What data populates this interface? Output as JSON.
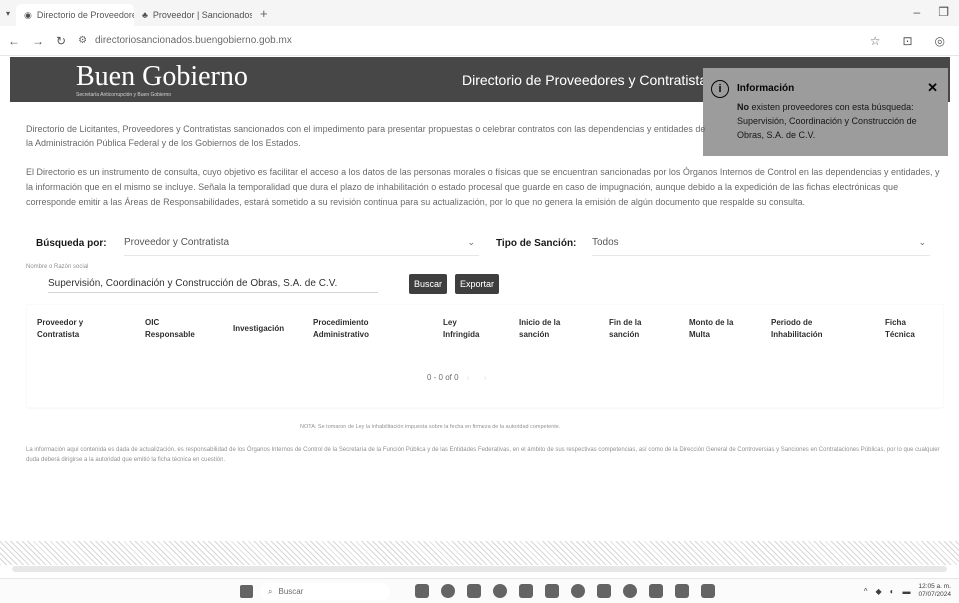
{
  "browser": {
    "tabs": [
      {
        "title": "Directorio de Proveedores y C",
        "active": true
      },
      {
        "title": "Proveedor | Sancionados",
        "active": false
      }
    ],
    "url": "directoriosancionados.buengobierno.gob.mx"
  },
  "header": {
    "brand": "Buen Gobierno",
    "brand_sub": "Secretaría Anticorrupción y Buen Gobierno",
    "title": "Directorio de Proveedores y Contratistas Sancionados"
  },
  "toast": {
    "title": "Información",
    "message_lead": "No",
    "message": "existen proveedores con esta búsqueda: Supervisión, Coordinación y Construcción de Obras, S.A. de C.V."
  },
  "intro": "Directorio de Licitantes, Proveedores y Contratistas sancionados con el impedimento para presentar propuestas o celebrar contratos con las dependencias y entidades de la Administración Pública Federal y de los Gobiernos de los Estados.",
  "paragraph": "El Directorio es un instrumento de consulta, cuyo objetivo es facilitar el acceso a los datos de las personas morales o físicas que se encuentran sancionadas por los Órganos Internos de Control en las dependencias y entidades, y la información que en el mismo se incluye. Señala la temporalidad que dura el plazo de inhabilitación o estado procesal que guarde en caso de impugnación, aunque debido a la expedición de las fichas electrónicas que corresponde emitir a las Áreas de Responsabilidades, estará sometido a su revisión continua para su actualización, por lo que no genera la emisión de algún documento que respalde su consulta.",
  "search": {
    "by_label": "Búsqueda por:",
    "by_value": "Proveedor y Contratista",
    "type_label": "Tipo de Sanción:",
    "type_value": "Todos",
    "hint": "Nombre o Razón social",
    "input_value": "Supervisión, Coordinación y Construcción de Obras, S.A. de C.V.",
    "search_button": "Buscar",
    "export_button": "Exportar"
  },
  "table": {
    "headers": [
      "Proveedor y Contratista",
      "OIC Responsable",
      "Investigación",
      "Procedimiento Administrativo",
      "Ley Infringida",
      "Inicio de la sanción",
      "Fin de la sanción",
      "Monto de la Multa",
      "Periodo de Inhabilitación",
      "Ficha Técnica"
    ],
    "pagination": "0 - 0 of 0"
  },
  "note": "NOTA: Se tomaron de Ley la inhabilitación impuesta sobre la fecha en firmeza de la autoridad competente.",
  "footer": "La información aquí contenida es dada de actualización, es responsabilidad de los Órganos Internos de Control de la Secretaría de la Función Pública y de las Entidades Federativas, en el ámbito de sus respectivas competencias, así como de la Dirección General de Controversias y Sanciones en Contrataciones Públicas, por lo que cualquier duda deberá dirigirse a la autoridad que emitió la ficha técnica en cuestión.",
  "taskbar": {
    "search_placeholder": "Buscar",
    "time": "12:05 a. m.",
    "date": "07/07/2024"
  }
}
